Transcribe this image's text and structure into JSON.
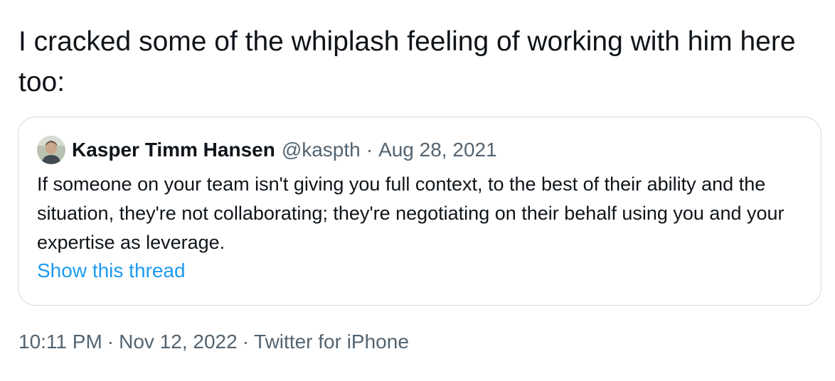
{
  "tweet": {
    "text": "I cracked some of the whiplash feeling of working with him here too:"
  },
  "quoted_tweet": {
    "author_name": "Kasper Timm Hansen",
    "author_handle": "@kaspth",
    "separator": "·",
    "date": "Aug 28, 2021",
    "text": "If someone on your team isn't giving you full context, to the best of their ability and the situation, they're not collaborating; they're negotiating on their behalf using you and your expertise as leverage.",
    "show_thread_label": "Show this thread"
  },
  "meta": {
    "time": "10:11 PM",
    "separator": "·",
    "date": "Nov 12, 2022",
    "source": "Twitter for iPhone"
  },
  "colors": {
    "text_primary": "#0f1419",
    "text_secondary": "#536471",
    "link": "#1d9bf0",
    "border": "#cfd9de"
  }
}
